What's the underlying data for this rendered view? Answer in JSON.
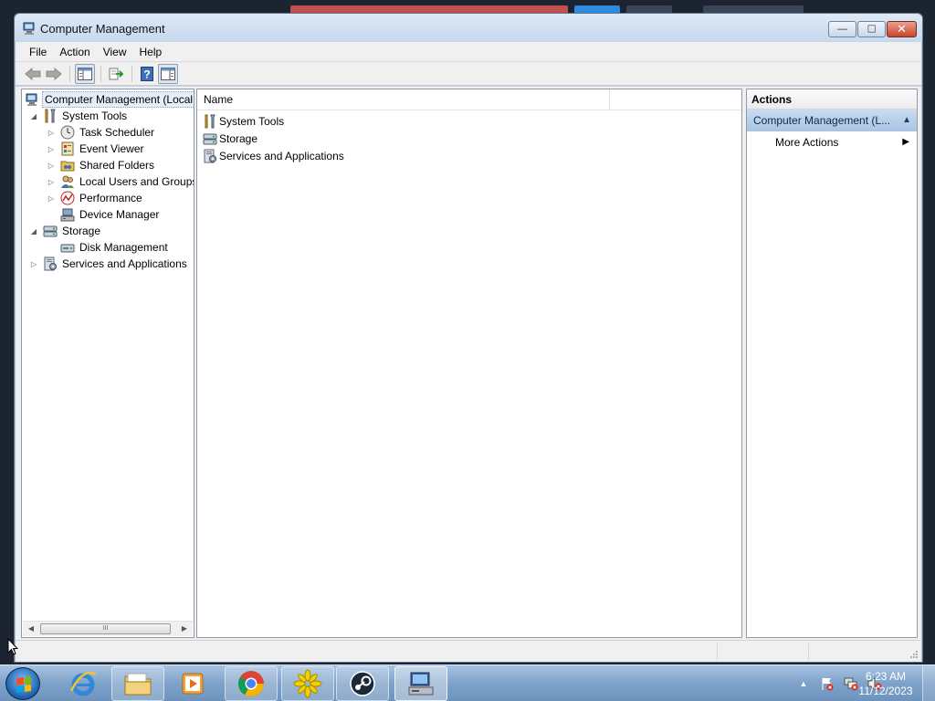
{
  "window": {
    "title": "Computer Management",
    "buttons": {
      "minimize": "—",
      "maximize": "☐",
      "close": "✕"
    }
  },
  "menu": [
    "File",
    "Action",
    "View",
    "Help"
  ],
  "toolbar": {
    "buttons": [
      "back-arrow-icon",
      "forward-arrow-icon",
      "show-hide-console-tree-icon",
      "export-list-icon",
      "help-icon",
      "show-hide-action-pane-icon"
    ]
  },
  "tree": {
    "root": "Computer Management (Local",
    "items": [
      {
        "label": "System Tools",
        "expander": "◢"
      },
      {
        "label": "Task Scheduler",
        "expander": "▷"
      },
      {
        "label": "Event Viewer",
        "expander": "▷"
      },
      {
        "label": "Shared Folders",
        "expander": "▷"
      },
      {
        "label": "Local Users and Groups",
        "expander": "▷"
      },
      {
        "label": "Performance",
        "expander": "▷"
      },
      {
        "label": "Device Manager",
        "expander": ""
      },
      {
        "label": "Storage",
        "expander": "◢"
      },
      {
        "label": "Disk Management",
        "expander": ""
      },
      {
        "label": "Services and Applications",
        "expander": "▷"
      }
    ],
    "scroll_left": "◀",
    "scroll_right": "▶",
    "scroll_thumb": "III"
  },
  "list": {
    "column_header": "Name",
    "rows": [
      "System Tools",
      "Storage",
      "Services and Applications"
    ]
  },
  "actions": {
    "header": "Actions",
    "group": "Computer Management (L...",
    "group_chevron": "▲",
    "item": "More Actions",
    "item_arrow": "▶"
  },
  "taskbar": {
    "apps": [
      "internet-explorer-icon",
      "windows-explorer-icon",
      "media-player-icon",
      "chrome-icon",
      "yellow-star-app-icon",
      "steam-icon",
      "computer-management-icon"
    ],
    "tray_arrow": "▲",
    "time": "6:23 AM",
    "date": "11/12/2023"
  },
  "colors": {
    "accent": "#a9c4e4",
    "selection": "#e6eef8",
    "taskbar": "#7fa2c9"
  }
}
